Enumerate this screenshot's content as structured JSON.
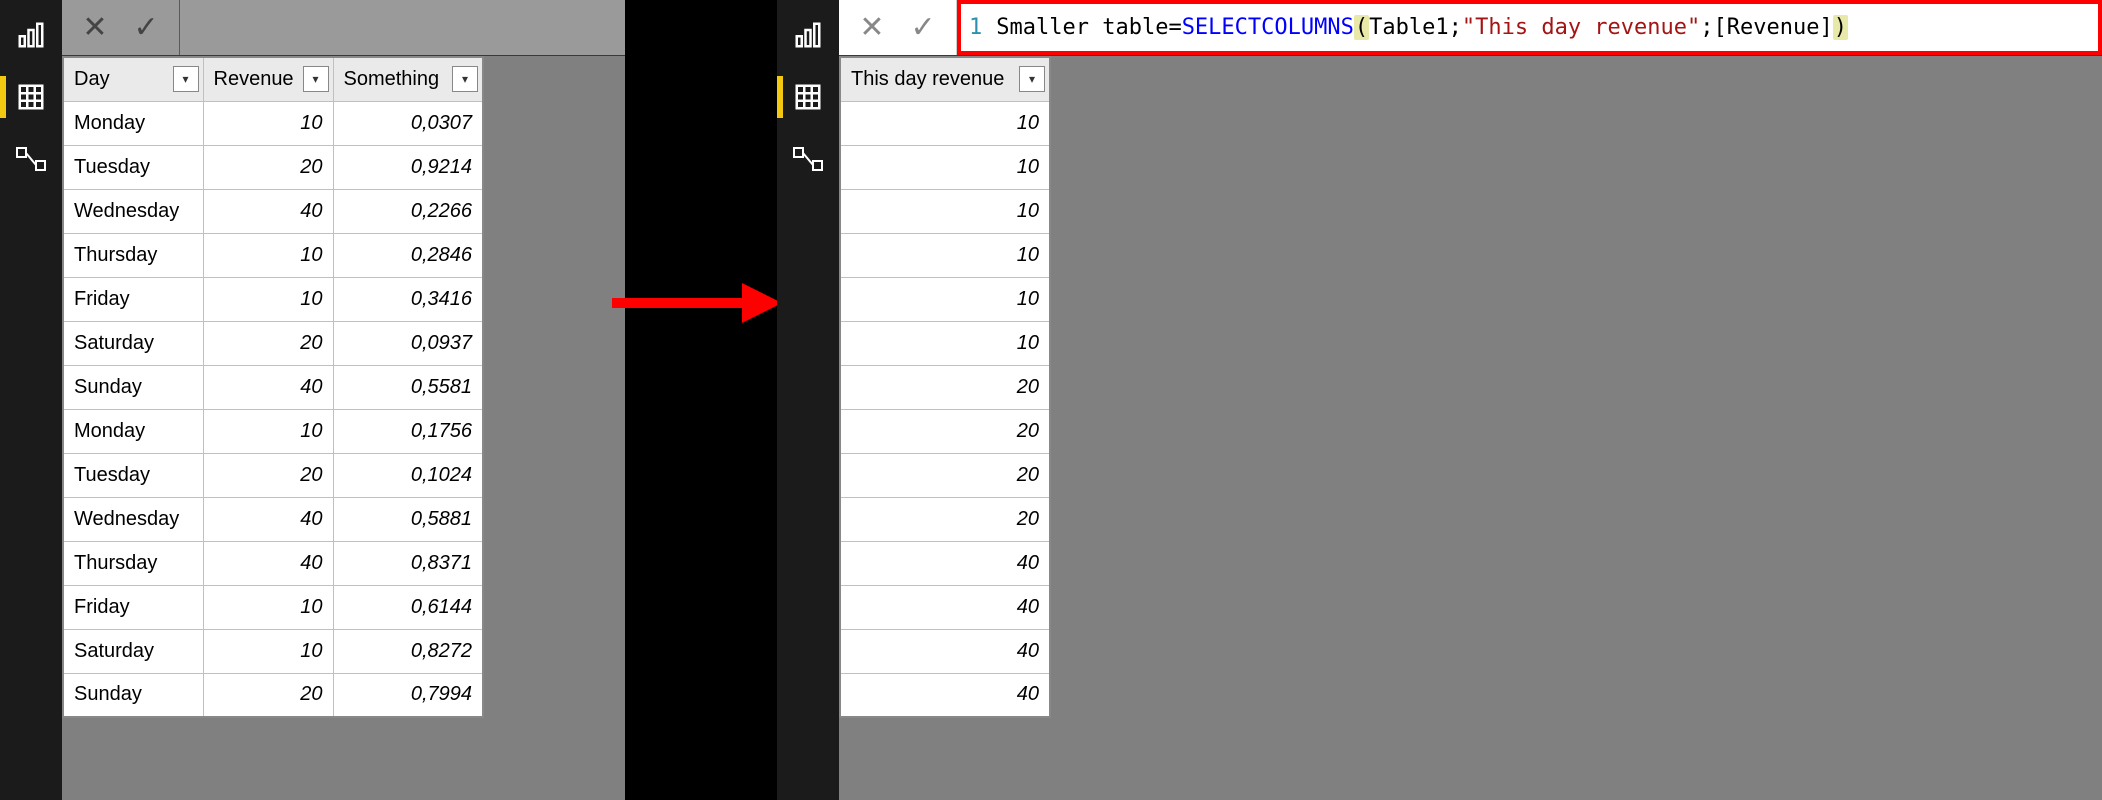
{
  "left": {
    "nav_active": 1,
    "columns": [
      "Day",
      "Revenue",
      "Something"
    ],
    "rows": [
      {
        "day": "Monday",
        "rev": "10",
        "some": "0,0307"
      },
      {
        "day": "Tuesday",
        "rev": "20",
        "some": "0,9214"
      },
      {
        "day": "Wednesday",
        "rev": "40",
        "some": "0,2266"
      },
      {
        "day": "Thursday",
        "rev": "10",
        "some": "0,2846"
      },
      {
        "day": "Friday",
        "rev": "10",
        "some": "0,3416"
      },
      {
        "day": "Saturday",
        "rev": "20",
        "some": "0,0937"
      },
      {
        "day": "Sunday",
        "rev": "40",
        "some": "0,5581"
      },
      {
        "day": "Monday",
        "rev": "10",
        "some": "0,1756"
      },
      {
        "day": "Tuesday",
        "rev": "20",
        "some": "0,1024"
      },
      {
        "day": "Wednesday",
        "rev": "40",
        "some": "0,5881"
      },
      {
        "day": "Thursday",
        "rev": "40",
        "some": "0,8371"
      },
      {
        "day": "Friday",
        "rev": "10",
        "some": "0,6144"
      },
      {
        "day": "Saturday",
        "rev": "10",
        "some": "0,8272"
      },
      {
        "day": "Sunday",
        "rev": "20",
        "some": "0,7994"
      }
    ]
  },
  "right": {
    "nav_active": 1,
    "formula": {
      "lineno": "1",
      "name": "Smaller table",
      "eq": " = ",
      "fn": "SELECTCOLUMNS",
      "open": "(",
      "arg1": "Table1",
      "sep1": ";",
      "arg2": "\"This day revenue\"",
      "sep2": ";",
      "arg3": "[Revenue]",
      "close": ")"
    },
    "columns": [
      "This day revenue"
    ],
    "rows": [
      "10",
      "10",
      "10",
      "10",
      "10",
      "10",
      "20",
      "20",
      "20",
      "20",
      "40",
      "40",
      "40",
      "40"
    ]
  }
}
